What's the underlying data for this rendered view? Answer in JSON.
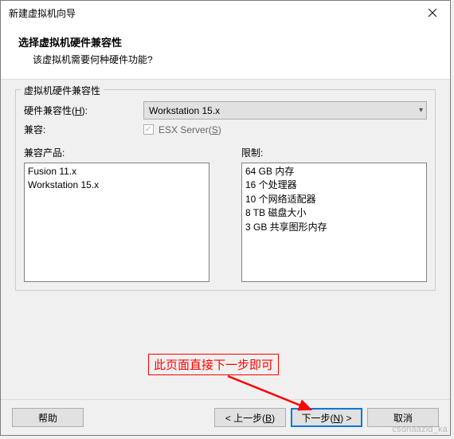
{
  "titlebar": {
    "title": "新建虚拟机向导"
  },
  "header": {
    "title": "选择虚拟机硬件兼容性",
    "subtitle": "该虚拟机需要何种硬件功能?"
  },
  "group": {
    "title": "虚拟机硬件兼容性",
    "compat_label_pre": "硬件兼容性(",
    "compat_label_u": "H",
    "compat_label_post": "):",
    "compat_value": "Workstation 15.x",
    "compat2_label": "兼容:",
    "esx_label_pre": "ESX Server(",
    "esx_label_u": "S",
    "esx_label_post": ")"
  },
  "lists": {
    "products_label": "兼容产品:",
    "products": [
      "Fusion 11.x",
      "Workstation 15.x"
    ],
    "limits_label": "限制:",
    "limits": [
      "64 GB 内存",
      "16 个处理器",
      "10 个网络适配器",
      "8 TB 磁盘大小",
      "3 GB 共享图形内存"
    ]
  },
  "buttons": {
    "help": "帮助",
    "back_pre": "< 上一步(",
    "back_u": "B",
    "back_post": ")",
    "next_pre": "下一步(",
    "next_u": "N",
    "next_post": ") >",
    "cancel": "取消"
  },
  "annotation": "此页面直接下一步即可",
  "watermark": "csdnaazid_ka",
  "colors": {
    "accent": "#0078d7",
    "annotation": "#ff0000"
  }
}
